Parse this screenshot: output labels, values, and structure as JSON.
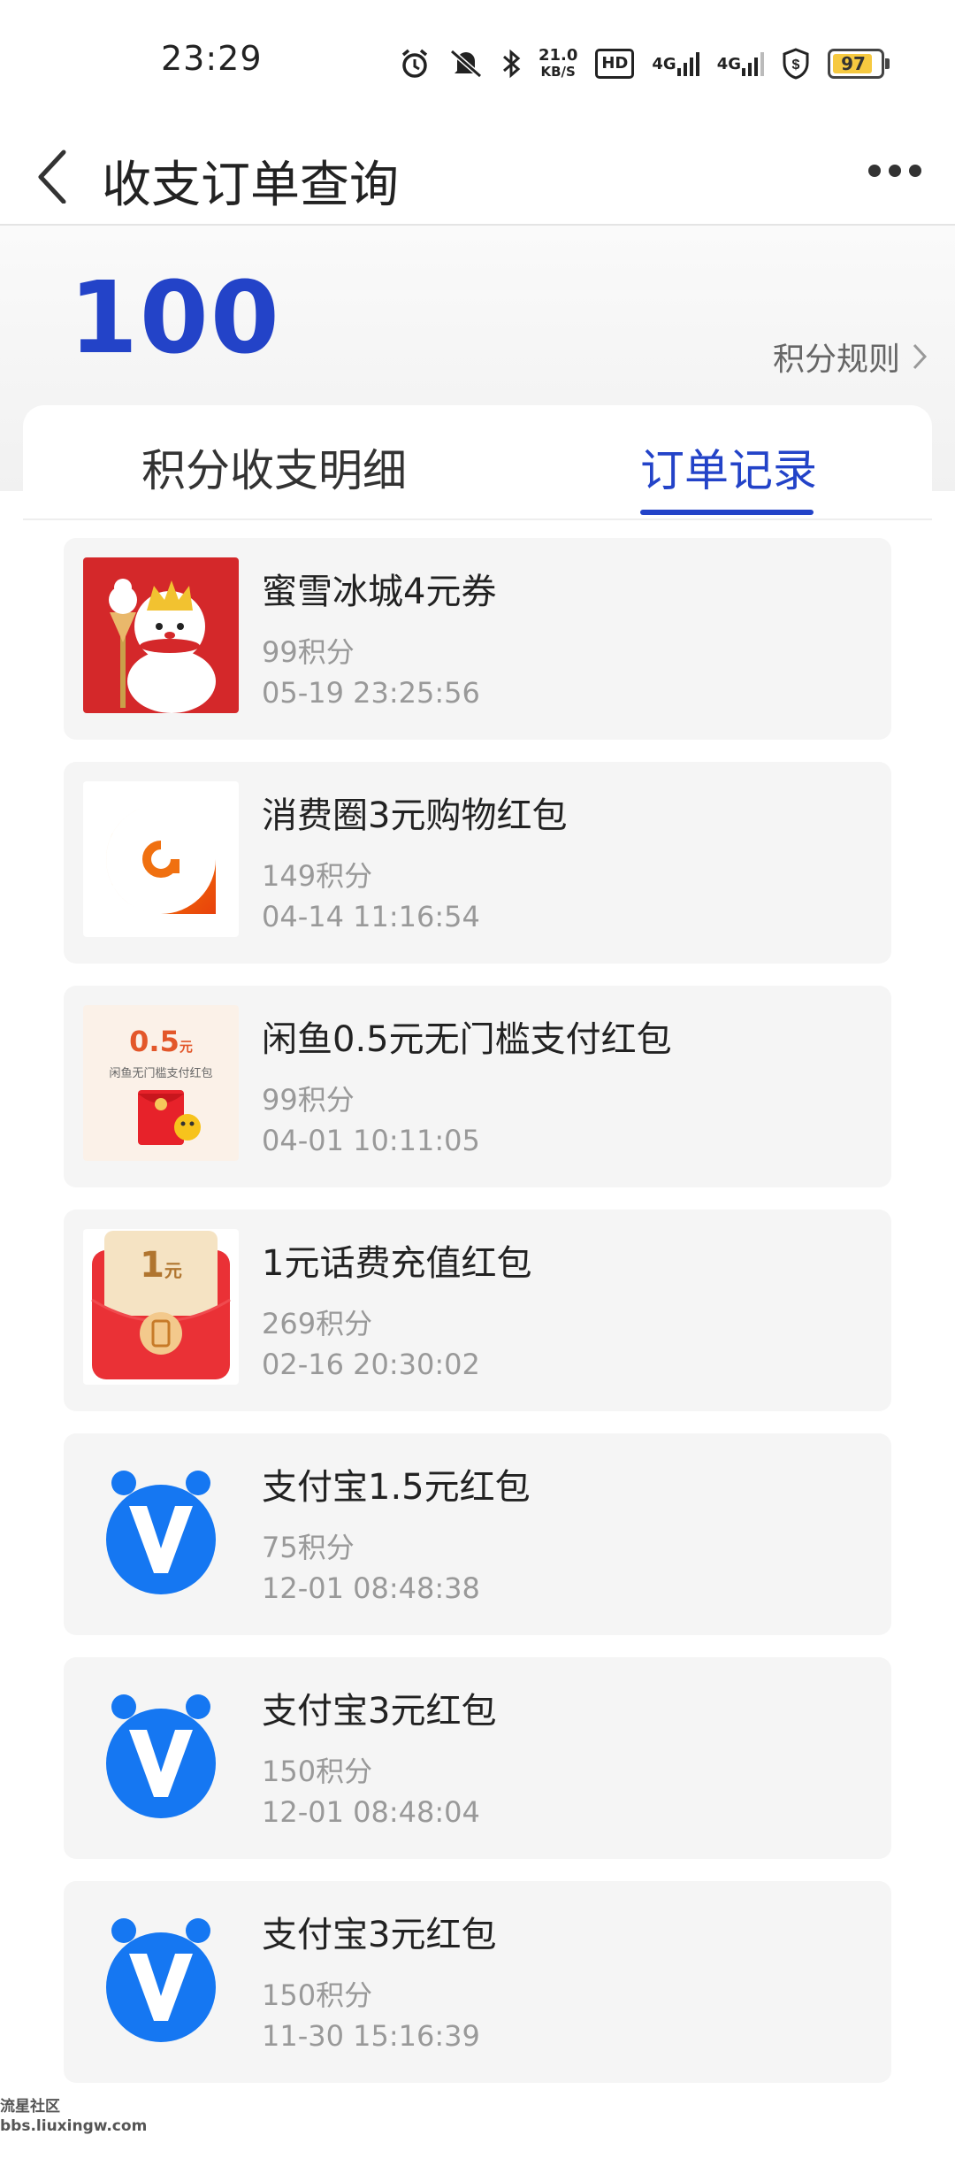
{
  "status_bar": {
    "time": "23:29",
    "net_speed_value": "21.0",
    "net_speed_unit": "KB/S",
    "hd_label": "HD",
    "sim1": "4G",
    "sim2": "4G",
    "battery": "97",
    "icons": [
      "alarm-icon",
      "mute-icon",
      "bluetooth-icon",
      "shield-icon"
    ]
  },
  "header": {
    "title": "收支订单查询"
  },
  "summary": {
    "points": "100",
    "rules_link": "积分规则"
  },
  "tabs": [
    {
      "label": "积分收支明细",
      "active": false
    },
    {
      "label": "订单记录",
      "active": true
    }
  ],
  "colors": {
    "accent": "#2343c8",
    "card_bg": "#f5f5f5",
    "muted_text": "#999999"
  },
  "orders": [
    {
      "name": "蜜雪冰城4元券",
      "cost": "99积分",
      "date": "05-19 23:25:56",
      "icon": "mixue-snowman-icon"
    },
    {
      "name": "消费圈3元购物红包",
      "cost": "149积分",
      "date": "04-14 11:16:54",
      "icon": "xiaofeiquan-logo-icon"
    },
    {
      "name": "闲鱼0.5元无门槛支付红包",
      "cost": "99积分",
      "date": "04-01 10:11:05",
      "icon": "xianyu-redpacket-icon",
      "thumb_amount": "0.5",
      "thumb_unit": "元",
      "thumb_caption": "闲鱼无门槛支付红包"
    },
    {
      "name": "1元话费充值红包",
      "cost": "269积分",
      "date": "02-16 20:30:02",
      "icon": "phone-redpacket-icon",
      "thumb_amount": "1",
      "thumb_unit": "元"
    },
    {
      "name": "支付宝1.5元红包",
      "cost": "75积分",
      "date": "12-01 08:48:38",
      "icon": "v-logo-icon"
    },
    {
      "name": "支付宝3元红包",
      "cost": "150积分",
      "date": "12-01 08:48:04",
      "icon": "v-logo-icon"
    },
    {
      "name": "支付宝3元红包",
      "cost": "150积分",
      "date": "11-30 15:16:39",
      "icon": "v-logo-icon"
    }
  ],
  "watermark": {
    "line1": "流星社区",
    "line2": "bbs.liuxingw.com"
  }
}
